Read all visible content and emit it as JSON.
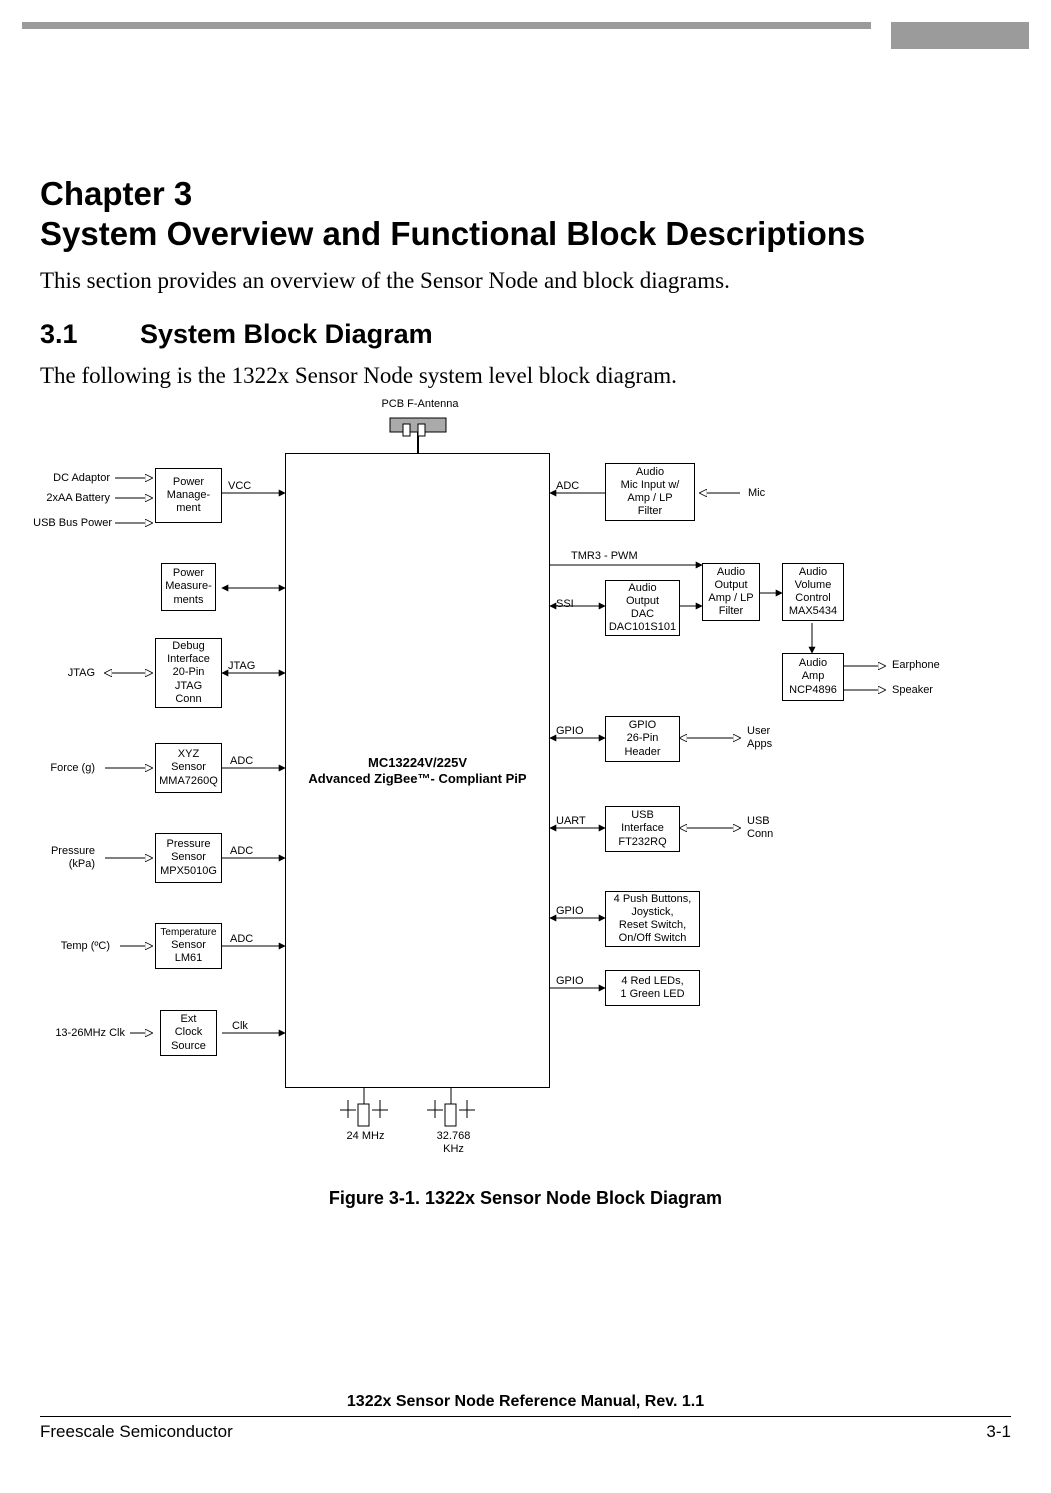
{
  "chapter": {
    "line1": "Chapter 3",
    "line2": "System Overview and Functional Block Descriptions"
  },
  "intro": "This section provides an overview of the Sensor Node and block diagrams.",
  "section": {
    "number": "3.1",
    "title": "System Block Diagram",
    "paragraph": "The following is the 1322x Sensor Node system level block diagram."
  },
  "figure": {
    "caption": "Figure 3-1. 1322x Sensor Node Block Diagram"
  },
  "footer": {
    "title": "1322x Sensor Node Reference Manual, Rev. 1.1",
    "left": "Freescale Semiconductor",
    "right": "3-1"
  },
  "diagram": {
    "top": {
      "antenna_label": "PCB F-Antenna"
    },
    "main_chip": {
      "line1": "MC13224V/225V",
      "line2": "Advanced ZigBee™- Compliant PiP"
    },
    "left_inputs": {
      "dc_adaptor": "DC Adaptor",
      "battery": "2xAA Battery",
      "usb_bus_power": "USB Bus Power",
      "jtag_left": "JTAG",
      "force": "Force (g)",
      "pressure_line1": "Pressure",
      "pressure_line2": "(kPa)",
      "temp": "Temp (ºC)",
      "ext_clk": "13-26MHz Clk"
    },
    "left_boxes": {
      "power_mgmt_l1": "Power",
      "power_mgmt_l2": "Manage-",
      "power_mgmt_l3": "ment",
      "power_meas_l1": "Power",
      "power_meas_l2": "Measure-",
      "power_meas_l3": "ments",
      "debug_l1": "Debug",
      "debug_l2": "Interface",
      "debug_l3": "20-Pin",
      "debug_l4": "JTAG",
      "debug_l5": "Conn",
      "xyz_l1": "XYZ",
      "xyz_l2": "Sensor",
      "xyz_l3": "MMA7260Q",
      "press_l1": "Pressure",
      "press_l2": "Sensor",
      "press_l3": "MPX5010G",
      "temp_l1": "Temperature",
      "temp_l2": "Sensor",
      "temp_l3": "LM61",
      "extclk_l1": "Ext",
      "extclk_l2": "Clock",
      "extclk_l3": "Source"
    },
    "left_conn_labels": {
      "vcc": "VCC",
      "jtag": "JTAG",
      "adc1": "ADC",
      "adc2": "ADC",
      "adc3": "ADC",
      "clk": "Clk"
    },
    "right_conn_labels": {
      "adc": "ADC",
      "tmr3": "TMR3 - PWM",
      "ssi": "SSI",
      "gpio1": "GPIO",
      "uart": "UART",
      "gpio2": "GPIO",
      "gpio3": "GPIO"
    },
    "right_boxes": {
      "mic_in_l1": "Audio",
      "mic_in_l2": "Mic Input w/",
      "mic_in_l3": "Amp / LP",
      "mic_in_l4": "Filter",
      "audio_dac_l1": "Audio",
      "audio_dac_l2": "Output",
      "audio_dac_l3": "DAC",
      "audio_dac_l4": "DAC101S101",
      "audio_amp_lp_l1": "Audio",
      "audio_amp_lp_l2": "Output",
      "audio_amp_lp_l3": "Amp / LP",
      "audio_amp_lp_l4": "Filter",
      "audio_vol_l1": "Audio",
      "audio_vol_l2": "Volume",
      "audio_vol_l3": "Control",
      "audio_vol_l4": "MAX5434",
      "audio_amp2_l1": "Audio",
      "audio_amp2_l2": "Amp",
      "audio_amp2_l3": "NCP4896",
      "gpio_hdr_l1": "GPIO",
      "gpio_hdr_l2": "26-Pin",
      "gpio_hdr_l3": "Header",
      "usb_if_l1": "USB",
      "usb_if_l2": "Interface",
      "usb_if_l3": "FT232RQ",
      "buttons_l1": "4 Push Buttons,",
      "buttons_l2": "Joystick,",
      "buttons_l3": "Reset Switch,",
      "buttons_l4": "On/Off Switch",
      "leds_l1": "4 Red LEDs,",
      "leds_l2": "1 Green LED"
    },
    "right_outputs": {
      "mic": "Mic",
      "earphone": "Earphone",
      "speaker": "Speaker",
      "user_apps_l1": "User",
      "user_apps_l2": "Apps",
      "usb_conn_l1": "USB",
      "usb_conn_l2": "Conn"
    },
    "bottom": {
      "x24": "24 MHz",
      "x32_l1": "32.768",
      "x32_l2": "KHz"
    }
  }
}
